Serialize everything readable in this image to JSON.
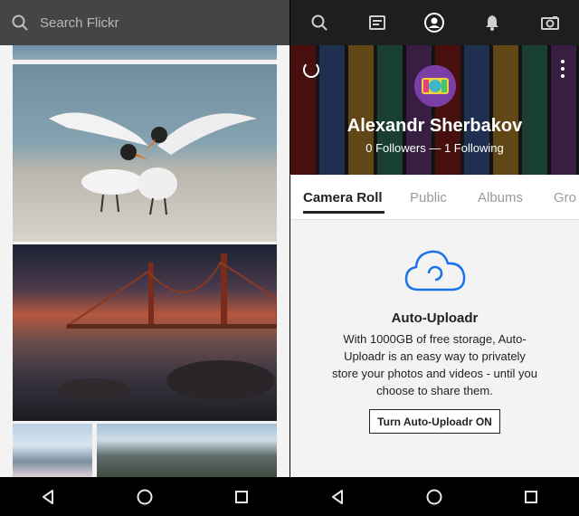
{
  "left_screen": {
    "search": {
      "placeholder": "Search Flickr",
      "icon": "search-icon"
    },
    "feed_photos": [
      {
        "description": "top partial photo"
      },
      {
        "description": "two terns on beach"
      },
      {
        "description": "golden gate bridge at sunset"
      },
      {
        "description": "city skyline with blossoms"
      },
      {
        "description": "mountains and water"
      }
    ]
  },
  "right_screen": {
    "nav_icons": [
      "search-icon",
      "feed-icon",
      "profile-icon",
      "bell-icon",
      "camera-icon"
    ],
    "profile": {
      "name": "Alexandr Sherbakov",
      "followers_text": "0 Followers — 1 Following"
    },
    "tabs": [
      {
        "label": "Camera Roll",
        "active": true
      },
      {
        "label": "Public",
        "active": false
      },
      {
        "label": "Albums",
        "active": false
      },
      {
        "label": "Gro",
        "active": false
      }
    ],
    "auto_uploadr": {
      "title": "Auto-Uploadr",
      "description": "With 1000GB of free storage, Auto-Uploadr is an easy way to privately store your photos and videos - until you choose to share them.",
      "button_label": "Turn Auto-Uploadr ON",
      "accent_color": "#1a73e8"
    }
  },
  "android_nav": [
    "back-icon",
    "home-icon",
    "recents-icon"
  ]
}
